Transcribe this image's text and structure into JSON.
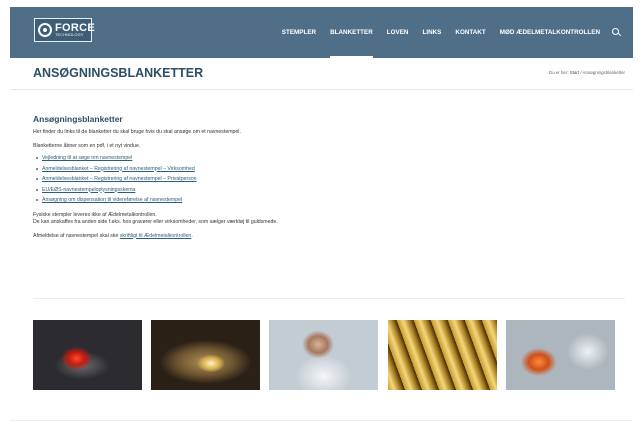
{
  "header": {
    "logo": {
      "word": "FORCE",
      "sub": "TECHNOLOGY"
    },
    "nav": [
      {
        "label": "STEMPLER",
        "active": false
      },
      {
        "label": "BLANKETTER",
        "active": true
      },
      {
        "label": "LOVEN",
        "active": false
      },
      {
        "label": "LINKS",
        "active": false
      },
      {
        "label": "KONTAKT",
        "active": false
      },
      {
        "label": "MØD ÆDELMETALKONTROLLEN",
        "active": false
      }
    ],
    "search_icon": "search-icon",
    "bar_color": "#4f6f88"
  },
  "title_bar": {
    "title": "ANSØGNINGSBLANKETTER",
    "breadcrumb": {
      "prefix": "Du er her:",
      "home": "Start",
      "sep": "/",
      "current": "Ansøgningsblanketter"
    }
  },
  "content": {
    "heading": "Ansøgningsblanketter",
    "intro": "Her finder du links til de blanketter du skal bruge hvis du skal ansøge om et navnestempel.",
    "pdf_note": "Blanketterne åbner som en pdf, i et nyt vindue.",
    "links": [
      "Vejledning til at søge om navnestempel",
      "Anmeldelsesblanket – Registrering af navnestempel – Virksomhed",
      "Anmeldelsesblanket – Registrering af navnestempel – Privatperson",
      "EU/EØS-navnestempeloplysningsskema",
      "Ansøgning om dispensation til videreførelse af navnestempel"
    ],
    "physical_1": "Fysiske stempler leveres ikke af Ædelmetalkontrollen.",
    "physical_2": "De kan anskaffes fra anden side f.eks. hos gravører eller virksomheder, som sælger værktøj til guldsmede.",
    "cancel_prefix": "Afmeldelse af navnestempel skal ske",
    "cancel_link": "skriftligt til Ædelmetalkontrollen",
    "cancel_suffix": "."
  },
  "accent_color": "#2c4e66"
}
